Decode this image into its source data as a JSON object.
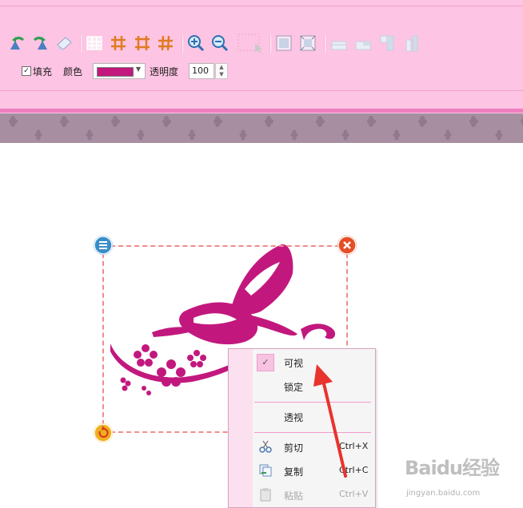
{
  "toolbar": {
    "icons": [
      "undo-icon",
      "redo-icon",
      "eraser-icon",
      "grid-icon",
      "hash-grid-icon",
      "frame-grid-icon",
      "hash-grid-alt-icon",
      "zoom-in-icon",
      "zoom-out-icon",
      "select-area-icon",
      "fit-frame-icon",
      "shrink-frame-icon",
      "align-bottom-icon",
      "align-bottom-alt-icon",
      "align-top-icon",
      "align-right-icon"
    ],
    "fill_label": "填充",
    "fill_checked": true,
    "color_label": "颜色",
    "color_value": "#c2187e",
    "opacity_label": "透明度",
    "opacity_value": "100"
  },
  "canvas": {
    "image_alt": "butterfly-flower-artwork",
    "image_color": "#c2187e"
  },
  "context_menu": {
    "items": [
      {
        "label": "可视",
        "shortcut": "",
        "checked": true,
        "disabled": false
      },
      {
        "label": "锁定",
        "shortcut": "",
        "checked": false,
        "disabled": false
      },
      {
        "label": "透视",
        "shortcut": "",
        "checked": false,
        "disabled": false
      },
      {
        "label": "剪切",
        "shortcut": "Ctrl+X",
        "checked": false,
        "disabled": false
      },
      {
        "label": "复制",
        "shortcut": "Ctrl+C",
        "checked": false,
        "disabled": false
      },
      {
        "label": "粘贴",
        "shortcut": "Ctrl+V",
        "checked": false,
        "disabled": true
      }
    ]
  },
  "watermark": {
    "logo": "Baidu经验",
    "url": "jingyan.baidu.com"
  },
  "colors": {
    "toolbar_bg": "#fdc4e3",
    "accent": "#ee7fbe",
    "arrow": "#e8332e"
  }
}
